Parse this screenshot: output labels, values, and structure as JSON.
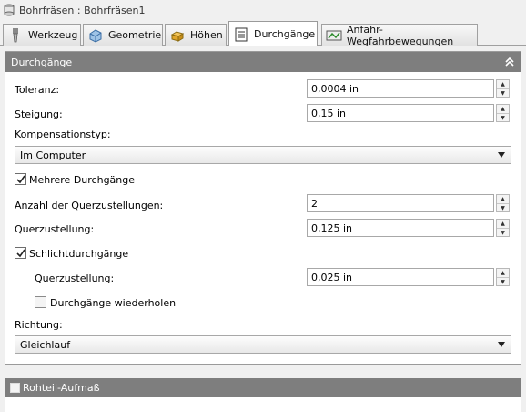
{
  "window": {
    "title": "Bohrfräsen : Bohrfräsen1"
  },
  "tabs": [
    {
      "label": "Werkzeug",
      "icon": "tool-icon"
    },
    {
      "label": "Geometrie",
      "icon": "geometry-icon"
    },
    {
      "label": "Höhen",
      "icon": "heights-icon"
    },
    {
      "label": "Durchgänge",
      "icon": "passes-icon",
      "active": true
    },
    {
      "label": "Anfahr-Wegfahrbewegungen",
      "icon": "linking-icon"
    }
  ],
  "panel": {
    "title": "Durchgänge",
    "toleranz": {
      "label": "Toleranz:",
      "value": "0,0004 in"
    },
    "steigung": {
      "label": "Steigung:",
      "value": "0,15 in"
    },
    "kompensationstyp": {
      "label": "Kompensationstyp:",
      "value": "Im Computer"
    },
    "mehrere": {
      "label": "Mehrere Durchgänge",
      "checked": true
    },
    "anzahl": {
      "label": "Anzahl der Querzustellungen:",
      "value": "2"
    },
    "querzustellung": {
      "label": "Querzustellung:",
      "value": "0,125 in"
    },
    "schlicht": {
      "label": "Schlichtdurchgänge",
      "checked": true
    },
    "schlicht_quer": {
      "label": "Querzustellung:",
      "value": "0,025 in"
    },
    "wiederholen": {
      "label": "Durchgänge wiederholen",
      "checked": false
    },
    "richtung": {
      "label": "Richtung:",
      "value": "Gleichlauf"
    }
  },
  "section2": {
    "title": "Rohteil-Aufmaß",
    "checked": false
  },
  "colors": {
    "header": "#7e7e7e",
    "background": "#f0f0f0"
  }
}
